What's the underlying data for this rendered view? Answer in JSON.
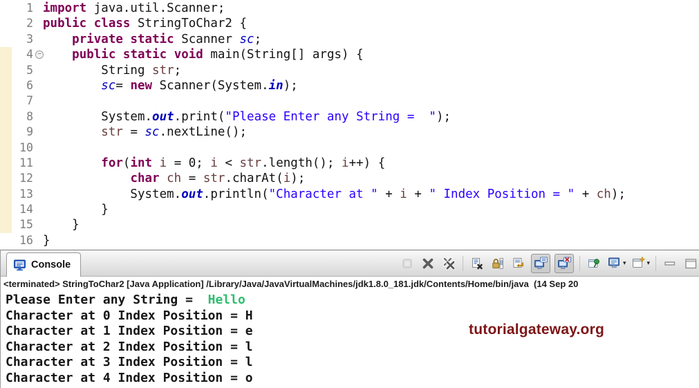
{
  "editor": {
    "lines": [
      {
        "n": "1",
        "tokens": [
          [
            "k",
            "import"
          ],
          [
            "d",
            " java.util.Scanner;"
          ]
        ]
      },
      {
        "n": "2",
        "tokens": [
          [
            "k",
            "public"
          ],
          [
            "d",
            " "
          ],
          [
            "k",
            "class"
          ],
          [
            "d",
            " StringToChar2 {"
          ]
        ]
      },
      {
        "n": "3",
        "tokens": [
          [
            "d",
            "    "
          ],
          [
            "k",
            "private"
          ],
          [
            "d",
            " "
          ],
          [
            "k",
            "static"
          ],
          [
            "d",
            " Scanner "
          ],
          [
            "f",
            "sc"
          ],
          [
            "d",
            ";"
          ]
        ]
      },
      {
        "n": "4",
        "marker": "collapse",
        "tokens": [
          [
            "d",
            "    "
          ],
          [
            "k",
            "public"
          ],
          [
            "d",
            " "
          ],
          [
            "k",
            "static"
          ],
          [
            "d",
            " "
          ],
          [
            "k",
            "void"
          ],
          [
            "d",
            " main(String[] args) {"
          ]
        ]
      },
      {
        "n": "5",
        "tokens": [
          [
            "d",
            "        String "
          ],
          [
            "v",
            "str"
          ],
          [
            "d",
            ";"
          ]
        ]
      },
      {
        "n": "6",
        "tokens": [
          [
            "d",
            "        "
          ],
          [
            "f",
            "sc"
          ],
          [
            "d",
            "= "
          ],
          [
            "k",
            "new"
          ],
          [
            "d",
            " Scanner(System."
          ],
          [
            "b",
            "in"
          ],
          [
            "d",
            ");"
          ]
        ]
      },
      {
        "n": "7",
        "tokens": []
      },
      {
        "n": "8",
        "tokens": [
          [
            "d",
            "        System."
          ],
          [
            "b",
            "out"
          ],
          [
            "d",
            ".print("
          ],
          [
            "s",
            "\"Please Enter any String =  \""
          ],
          [
            "d",
            ");"
          ]
        ]
      },
      {
        "n": "9",
        "tokens": [
          [
            "d",
            "        "
          ],
          [
            "v",
            "str"
          ],
          [
            "d",
            " = "
          ],
          [
            "f",
            "sc"
          ],
          [
            "d",
            ".nextLine();"
          ]
        ]
      },
      {
        "n": "10",
        "tokens": []
      },
      {
        "n": "11",
        "tokens": [
          [
            "d",
            "        "
          ],
          [
            "k",
            "for"
          ],
          [
            "d",
            "("
          ],
          [
            "k",
            "int"
          ],
          [
            "d",
            " "
          ],
          [
            "v",
            "i"
          ],
          [
            "d",
            " = 0; "
          ],
          [
            "v",
            "i"
          ],
          [
            "d",
            " < "
          ],
          [
            "v",
            "str"
          ],
          [
            "d",
            ".length(); "
          ],
          [
            "v",
            "i"
          ],
          [
            "d",
            "++) {"
          ]
        ]
      },
      {
        "n": "12",
        "tokens": [
          [
            "d",
            "            "
          ],
          [
            "k",
            "char"
          ],
          [
            "d",
            " "
          ],
          [
            "v",
            "ch"
          ],
          [
            "d",
            " = "
          ],
          [
            "v",
            "str"
          ],
          [
            "d",
            ".charAt("
          ],
          [
            "v",
            "i"
          ],
          [
            "d",
            ");"
          ]
        ]
      },
      {
        "n": "13",
        "tokens": [
          [
            "d",
            "            System."
          ],
          [
            "b",
            "out"
          ],
          [
            "d",
            ".println("
          ],
          [
            "s",
            "\"Character at \""
          ],
          [
            "d",
            " + "
          ],
          [
            "v",
            "i"
          ],
          [
            "d",
            " + "
          ],
          [
            "s",
            "\" Index Position = \""
          ],
          [
            "d",
            " + "
          ],
          [
            "v",
            "ch"
          ],
          [
            "d",
            ");"
          ]
        ]
      },
      {
        "n": "14",
        "tokens": [
          [
            "d",
            "        }"
          ]
        ]
      },
      {
        "n": "15",
        "tokens": [
          [
            "d",
            "    }"
          ]
        ]
      },
      {
        "n": "16",
        "tokens": [
          [
            "d",
            "}"
          ]
        ]
      }
    ]
  },
  "console": {
    "tab_label": "Console",
    "status_line": "<terminated> StringToChar2 [Java Application] /Library/Java/JavaVirtualMachines/jdk1.8.0_181.jdk/Contents/Home/bin/java  (14 Sep 20",
    "toolbar_icons": [
      "terminate",
      "remove-launch",
      "remove-all-terminated-launches",
      "clear-console",
      "scroll-lock",
      "word-wrap",
      "show-console-on-stdout-change",
      "show-console-on-stderr-change",
      "pin-console",
      "display-selected-console",
      "open-console",
      "minimize",
      "maximize"
    ],
    "output": [
      {
        "segments": [
          [
            "out",
            "Please Enter any String =  "
          ],
          [
            "in",
            "Hello"
          ]
        ]
      },
      {
        "segments": [
          [
            "out",
            "Character at 0 Index Position = H"
          ]
        ]
      },
      {
        "segments": [
          [
            "out",
            "Character at 1 Index Position = e"
          ]
        ]
      },
      {
        "segments": [
          [
            "out",
            "Character at 2 Index Position = l"
          ]
        ]
      },
      {
        "segments": [
          [
            "out",
            "Character at 3 Index Position = l"
          ]
        ]
      },
      {
        "segments": [
          [
            "out",
            "Character at 4 Index Position = o"
          ]
        ]
      }
    ],
    "watermark": "tutorialgateway.org"
  },
  "colors": {
    "keyword": "#7f0055",
    "string": "#2a00ff",
    "static_field": "#0000c0",
    "local_variable": "#6a3e3e",
    "console_input_green": "#2ebe6e",
    "watermark_red": "#7d1517",
    "gutter_band": "#faf0d2"
  }
}
